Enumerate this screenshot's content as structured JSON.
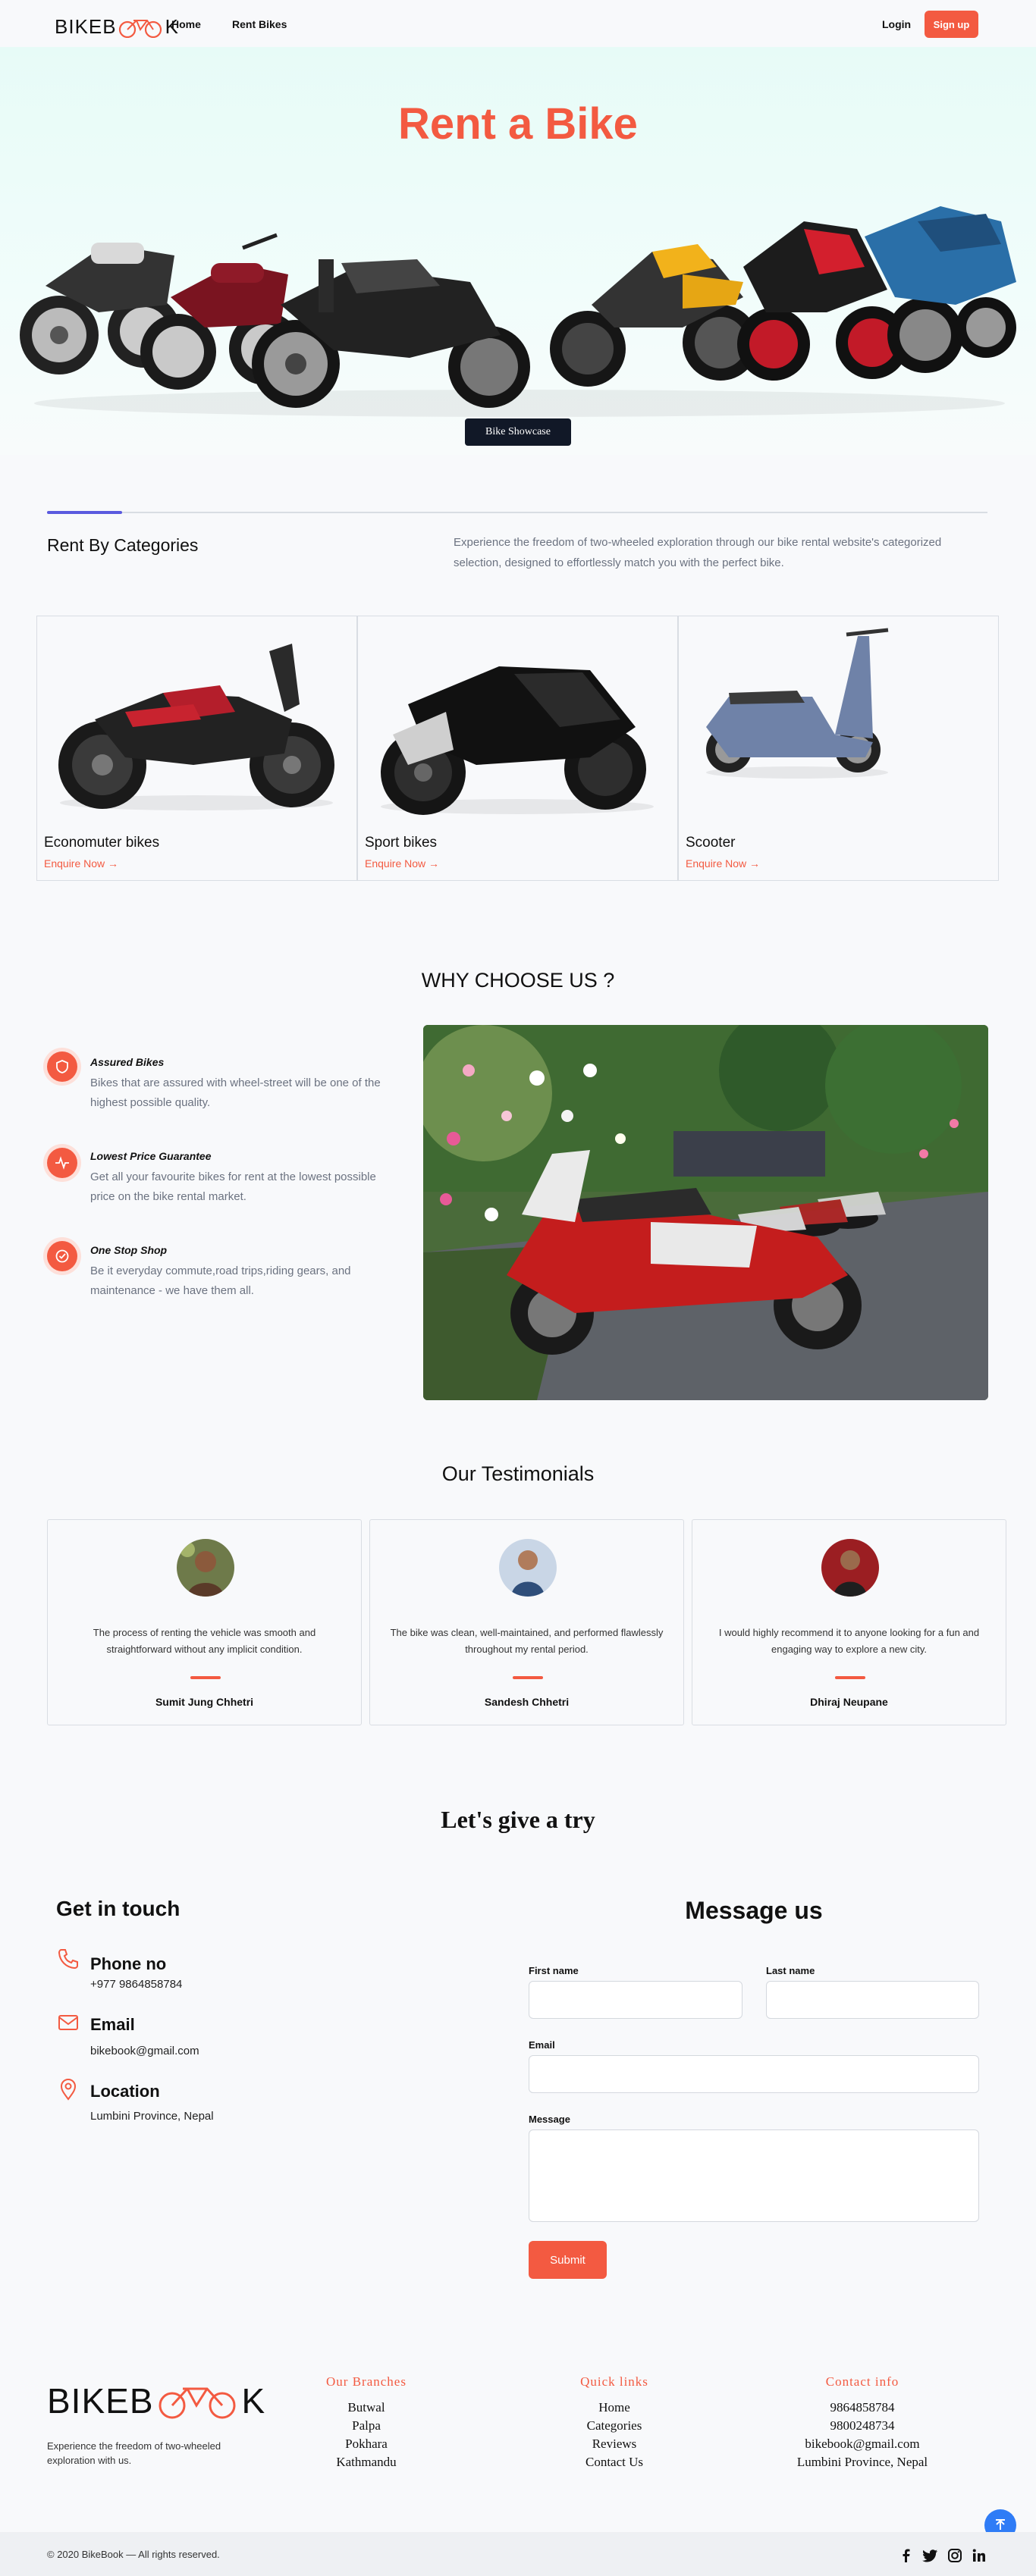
{
  "header": {
    "logo": "BIKEB",
    "logo_tail": "K",
    "nav": [
      "Home",
      "Rent Bikes"
    ],
    "login": "Login",
    "signup": "Sign up"
  },
  "hero": {
    "title": "Rent a Bike",
    "button": "Bike Showcase"
  },
  "categories": {
    "progress": 0.08,
    "title": "Rent By Categories",
    "description": "Experience the freedom of two-wheeled exploration through our bike rental website's categorized selection, designed to effortlessly match you with the perfect bike.",
    "cards": [
      {
        "name": "Economuter bikes",
        "link": "Enquire Now"
      },
      {
        "name": "Sport bikes",
        "link": "Enquire Now"
      },
      {
        "name": "Scooter",
        "link": "Enquire Now"
      }
    ]
  },
  "why": {
    "title": "WHY CHOOSE US ?",
    "features": [
      {
        "name": "Assured Bikes",
        "desc": "Bikes that are assured with wheel-street will be one of the highest possible quality."
      },
      {
        "name": "Lowest Price Guarantee",
        "desc": "Get all your favourite bikes for rent at the lowest possible price on the bike rental market."
      },
      {
        "name": "One Stop Shop",
        "desc": "Be it everyday commute,road trips,riding gears, and maintenance - we have them all."
      }
    ]
  },
  "testimonials": {
    "title": "Our Testimonials",
    "items": [
      {
        "text": "The process of renting the vehicle was smooth and straightforward without any implicit condition.",
        "name": "Sumit Jung Chhetri"
      },
      {
        "text": "The bike was clean, well-maintained, and performed flawlessly throughout my rental period.",
        "name": "Sandesh Chhetri"
      },
      {
        "text": "I would highly recommend it to anyone looking for a fun and engaging way to explore a new city.",
        "name": "Dhiraj Neupane"
      }
    ]
  },
  "contact": {
    "try_title": "Let's give a try",
    "get_in_touch": "Get in touch",
    "phone_label": "Phone no",
    "phone_value": "+977 9864858784",
    "email_label": "Email",
    "email_value": "bikebook@gmail.com",
    "location_label": "Location",
    "location_value": "Lumbini Province, Nepal",
    "message_title": "Message us",
    "first_name": "First name",
    "last_name": "Last name",
    "email": "Email",
    "message": "Message",
    "submit": "Submit"
  },
  "footer": {
    "logo": "BIKEB",
    "logo_tail": "K",
    "desc": "Experience the freedom of two-wheeled exploration with us.",
    "branches_title": "Our Branches",
    "branches": [
      "Butwal",
      "Palpa",
      "Pokhara",
      "Kathmandu"
    ],
    "links_title": "Quick links",
    "links": [
      "Home",
      "Categories",
      "Reviews",
      "Contact Us"
    ],
    "info_title": "Contact info",
    "info": [
      "9864858784",
      "9800248734",
      "bikebook@gmail.com",
      "Lumbini Province, Nepal"
    ],
    "copyright": "© 2020 BikeBook — All rights reserved."
  },
  "colors": {
    "accent": "#f35a41",
    "dark": "#111827",
    "blue": "#2f7cf6"
  }
}
